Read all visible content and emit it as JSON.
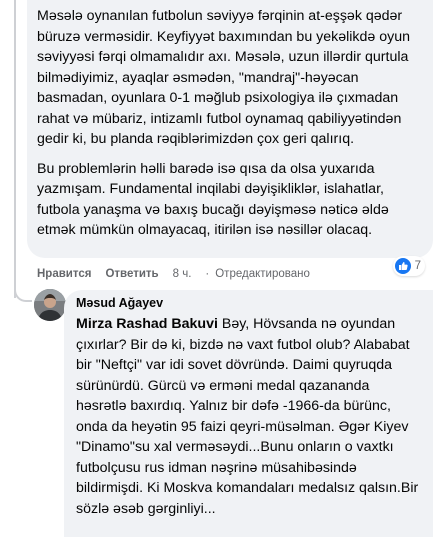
{
  "comment1": {
    "paragraph1": "Məsələ oynanılan futbolun səviyyə fərqinin at-eşşək qədər büruzə verməsidir. Keyfiyyət baxımından bu yekəlikdə oyun səviyyəsi fərqi olmamalıdır axı. Məsələ, uzun illərdir qurtula bilmədiyimiz, ayaqlar əsmədən, \"mandraj\"-həyəcan basmadan, oyunlara 0-1 məğlub psixologiya ilə çıxmadan rahat və mübariz, intizamlı futbol oynamaq qabiliyyətindən gedir ki, bu planda rəqiblərimizdən çox geri qalırıq.",
    "paragraph2": "Bu problemlərin həlli barədə isə qısa da olsa yuxarıda yazmışam. Fundamental inqilabi dəyişikliklər, islahatlar, futbola yanaşma və baxış bucağı dəyişməsə nəticə əldə etmək mümkün olmayacaq, itirilən isə nəsillər olacaq.",
    "like_label": "Нравится",
    "reply_label": "Ответить",
    "time": "8 ч.",
    "separator": "·",
    "edited_label": "Отредактировано",
    "reaction_count": "7"
  },
  "comment2": {
    "author": "Məsud Ağayev",
    "mention": "Mirza Rashad Bakuvi",
    "text": " Bəy, Hövsanda nə oyundan çıxırlar? Bir də ki, bizdə nə vaxt futbol olub? Alababat bir \"Neftçi\" var idi sovet dövründə. Daimi quyruqda sürünürdü. Gürcü və erməni medal qazananda həsrətlə baxırdıq. Yalnız bir dəfə -1966-da bürünc, onda da heyətin 95 faizi qeyri-müsəlman. Əgər Kiyev \"Dinamo\"su xal verməsəydi...Bunu onların o vaxtkı futbolçusu rus idman nəşrinə müsahibəsində bildirmişdi. Ki Moskva komandaları medalsız qalsın.Bir sözlə əsəb gərginliyi..."
  },
  "colors": {
    "bubble": "#f0f2f5",
    "meta_text": "#65676b",
    "like_blue": "#1877f2"
  }
}
